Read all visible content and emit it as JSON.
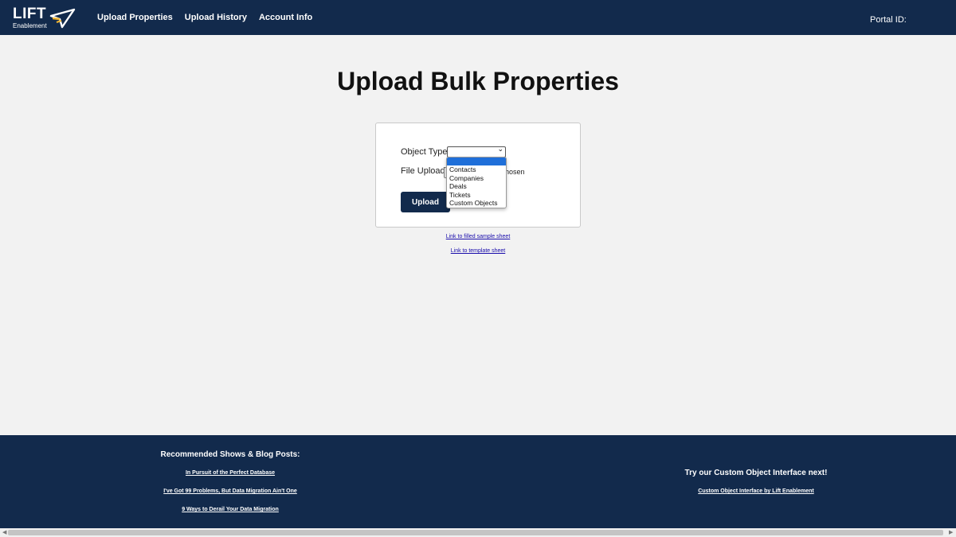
{
  "header": {
    "logo_text": "LIFT",
    "logo_sub": "Enablement",
    "nav": [
      "Upload Properties",
      "Upload History",
      "Account Info"
    ],
    "portal_label": "Portal ID:"
  },
  "main": {
    "title": "Upload Bulk Properties",
    "object_type_label": "Object Type:",
    "file_upload_label": "File Upload:",
    "file_status": "e chosen",
    "upload_button": "Upload",
    "dropdown_options": [
      "",
      "Contacts",
      "Companies",
      "Deals",
      "Tickets",
      "Custom Objects"
    ],
    "link_sample": "Link to filled sample sheet",
    "link_template": "Link to template sheet"
  },
  "footer": {
    "left_heading": "Recommended Shows & Blog Posts:",
    "left_links": [
      "In Pursuit of the Perfect Database",
      "I've Got 99 Problems, But Data Migration Ain't One",
      "9 Ways to Derail Your Data Migration"
    ],
    "right_heading": "Try our Custom Object Interface next!",
    "right_link": "Custom Object Interface by Lift Enablement"
  },
  "colors": {
    "navy": "#122a4c",
    "background": "#f2f2f2",
    "dropdown_highlight": "#1f6fd9",
    "link": "#1a0dab"
  },
  "icons": {
    "logo_mark": "paper-plane-icon",
    "select_arrow": "chevron-down-icon",
    "scroll_left": "arrow-left-icon",
    "scroll_right": "arrow-right-icon"
  }
}
